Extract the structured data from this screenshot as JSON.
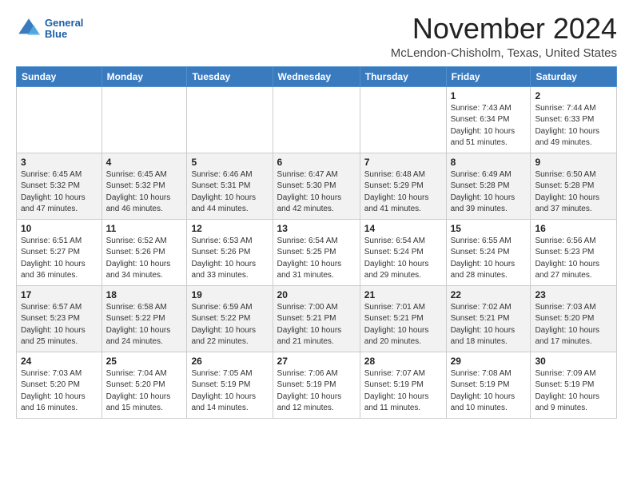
{
  "header": {
    "logo_line1": "General",
    "logo_line2": "Blue",
    "month": "November 2024",
    "location": "McLendon-Chisholm, Texas, United States"
  },
  "days_of_week": [
    "Sunday",
    "Monday",
    "Tuesday",
    "Wednesday",
    "Thursday",
    "Friday",
    "Saturday"
  ],
  "weeks": [
    [
      {
        "day": "",
        "info": ""
      },
      {
        "day": "",
        "info": ""
      },
      {
        "day": "",
        "info": ""
      },
      {
        "day": "",
        "info": ""
      },
      {
        "day": "",
        "info": ""
      },
      {
        "day": "1",
        "info": "Sunrise: 7:43 AM\nSunset: 6:34 PM\nDaylight: 10 hours and 51 minutes."
      },
      {
        "day": "2",
        "info": "Sunrise: 7:44 AM\nSunset: 6:33 PM\nDaylight: 10 hours and 49 minutes."
      }
    ],
    [
      {
        "day": "3",
        "info": "Sunrise: 6:45 AM\nSunset: 5:32 PM\nDaylight: 10 hours and 47 minutes."
      },
      {
        "day": "4",
        "info": "Sunrise: 6:45 AM\nSunset: 5:32 PM\nDaylight: 10 hours and 46 minutes."
      },
      {
        "day": "5",
        "info": "Sunrise: 6:46 AM\nSunset: 5:31 PM\nDaylight: 10 hours and 44 minutes."
      },
      {
        "day": "6",
        "info": "Sunrise: 6:47 AM\nSunset: 5:30 PM\nDaylight: 10 hours and 42 minutes."
      },
      {
        "day": "7",
        "info": "Sunrise: 6:48 AM\nSunset: 5:29 PM\nDaylight: 10 hours and 41 minutes."
      },
      {
        "day": "8",
        "info": "Sunrise: 6:49 AM\nSunset: 5:28 PM\nDaylight: 10 hours and 39 minutes."
      },
      {
        "day": "9",
        "info": "Sunrise: 6:50 AM\nSunset: 5:28 PM\nDaylight: 10 hours and 37 minutes."
      }
    ],
    [
      {
        "day": "10",
        "info": "Sunrise: 6:51 AM\nSunset: 5:27 PM\nDaylight: 10 hours and 36 minutes."
      },
      {
        "day": "11",
        "info": "Sunrise: 6:52 AM\nSunset: 5:26 PM\nDaylight: 10 hours and 34 minutes."
      },
      {
        "day": "12",
        "info": "Sunrise: 6:53 AM\nSunset: 5:26 PM\nDaylight: 10 hours and 33 minutes."
      },
      {
        "day": "13",
        "info": "Sunrise: 6:54 AM\nSunset: 5:25 PM\nDaylight: 10 hours and 31 minutes."
      },
      {
        "day": "14",
        "info": "Sunrise: 6:54 AM\nSunset: 5:24 PM\nDaylight: 10 hours and 29 minutes."
      },
      {
        "day": "15",
        "info": "Sunrise: 6:55 AM\nSunset: 5:24 PM\nDaylight: 10 hours and 28 minutes."
      },
      {
        "day": "16",
        "info": "Sunrise: 6:56 AM\nSunset: 5:23 PM\nDaylight: 10 hours and 27 minutes."
      }
    ],
    [
      {
        "day": "17",
        "info": "Sunrise: 6:57 AM\nSunset: 5:23 PM\nDaylight: 10 hours and 25 minutes."
      },
      {
        "day": "18",
        "info": "Sunrise: 6:58 AM\nSunset: 5:22 PM\nDaylight: 10 hours and 24 minutes."
      },
      {
        "day": "19",
        "info": "Sunrise: 6:59 AM\nSunset: 5:22 PM\nDaylight: 10 hours and 22 minutes."
      },
      {
        "day": "20",
        "info": "Sunrise: 7:00 AM\nSunset: 5:21 PM\nDaylight: 10 hours and 21 minutes."
      },
      {
        "day": "21",
        "info": "Sunrise: 7:01 AM\nSunset: 5:21 PM\nDaylight: 10 hours and 20 minutes."
      },
      {
        "day": "22",
        "info": "Sunrise: 7:02 AM\nSunset: 5:21 PM\nDaylight: 10 hours and 18 minutes."
      },
      {
        "day": "23",
        "info": "Sunrise: 7:03 AM\nSunset: 5:20 PM\nDaylight: 10 hours and 17 minutes."
      }
    ],
    [
      {
        "day": "24",
        "info": "Sunrise: 7:03 AM\nSunset: 5:20 PM\nDaylight: 10 hours and 16 minutes."
      },
      {
        "day": "25",
        "info": "Sunrise: 7:04 AM\nSunset: 5:20 PM\nDaylight: 10 hours and 15 minutes."
      },
      {
        "day": "26",
        "info": "Sunrise: 7:05 AM\nSunset: 5:19 PM\nDaylight: 10 hours and 14 minutes."
      },
      {
        "day": "27",
        "info": "Sunrise: 7:06 AM\nSunset: 5:19 PM\nDaylight: 10 hours and 12 minutes."
      },
      {
        "day": "28",
        "info": "Sunrise: 7:07 AM\nSunset: 5:19 PM\nDaylight: 10 hours and 11 minutes."
      },
      {
        "day": "29",
        "info": "Sunrise: 7:08 AM\nSunset: 5:19 PM\nDaylight: 10 hours and 10 minutes."
      },
      {
        "day": "30",
        "info": "Sunrise: 7:09 AM\nSunset: 5:19 PM\nDaylight: 10 hours and 9 minutes."
      }
    ]
  ]
}
